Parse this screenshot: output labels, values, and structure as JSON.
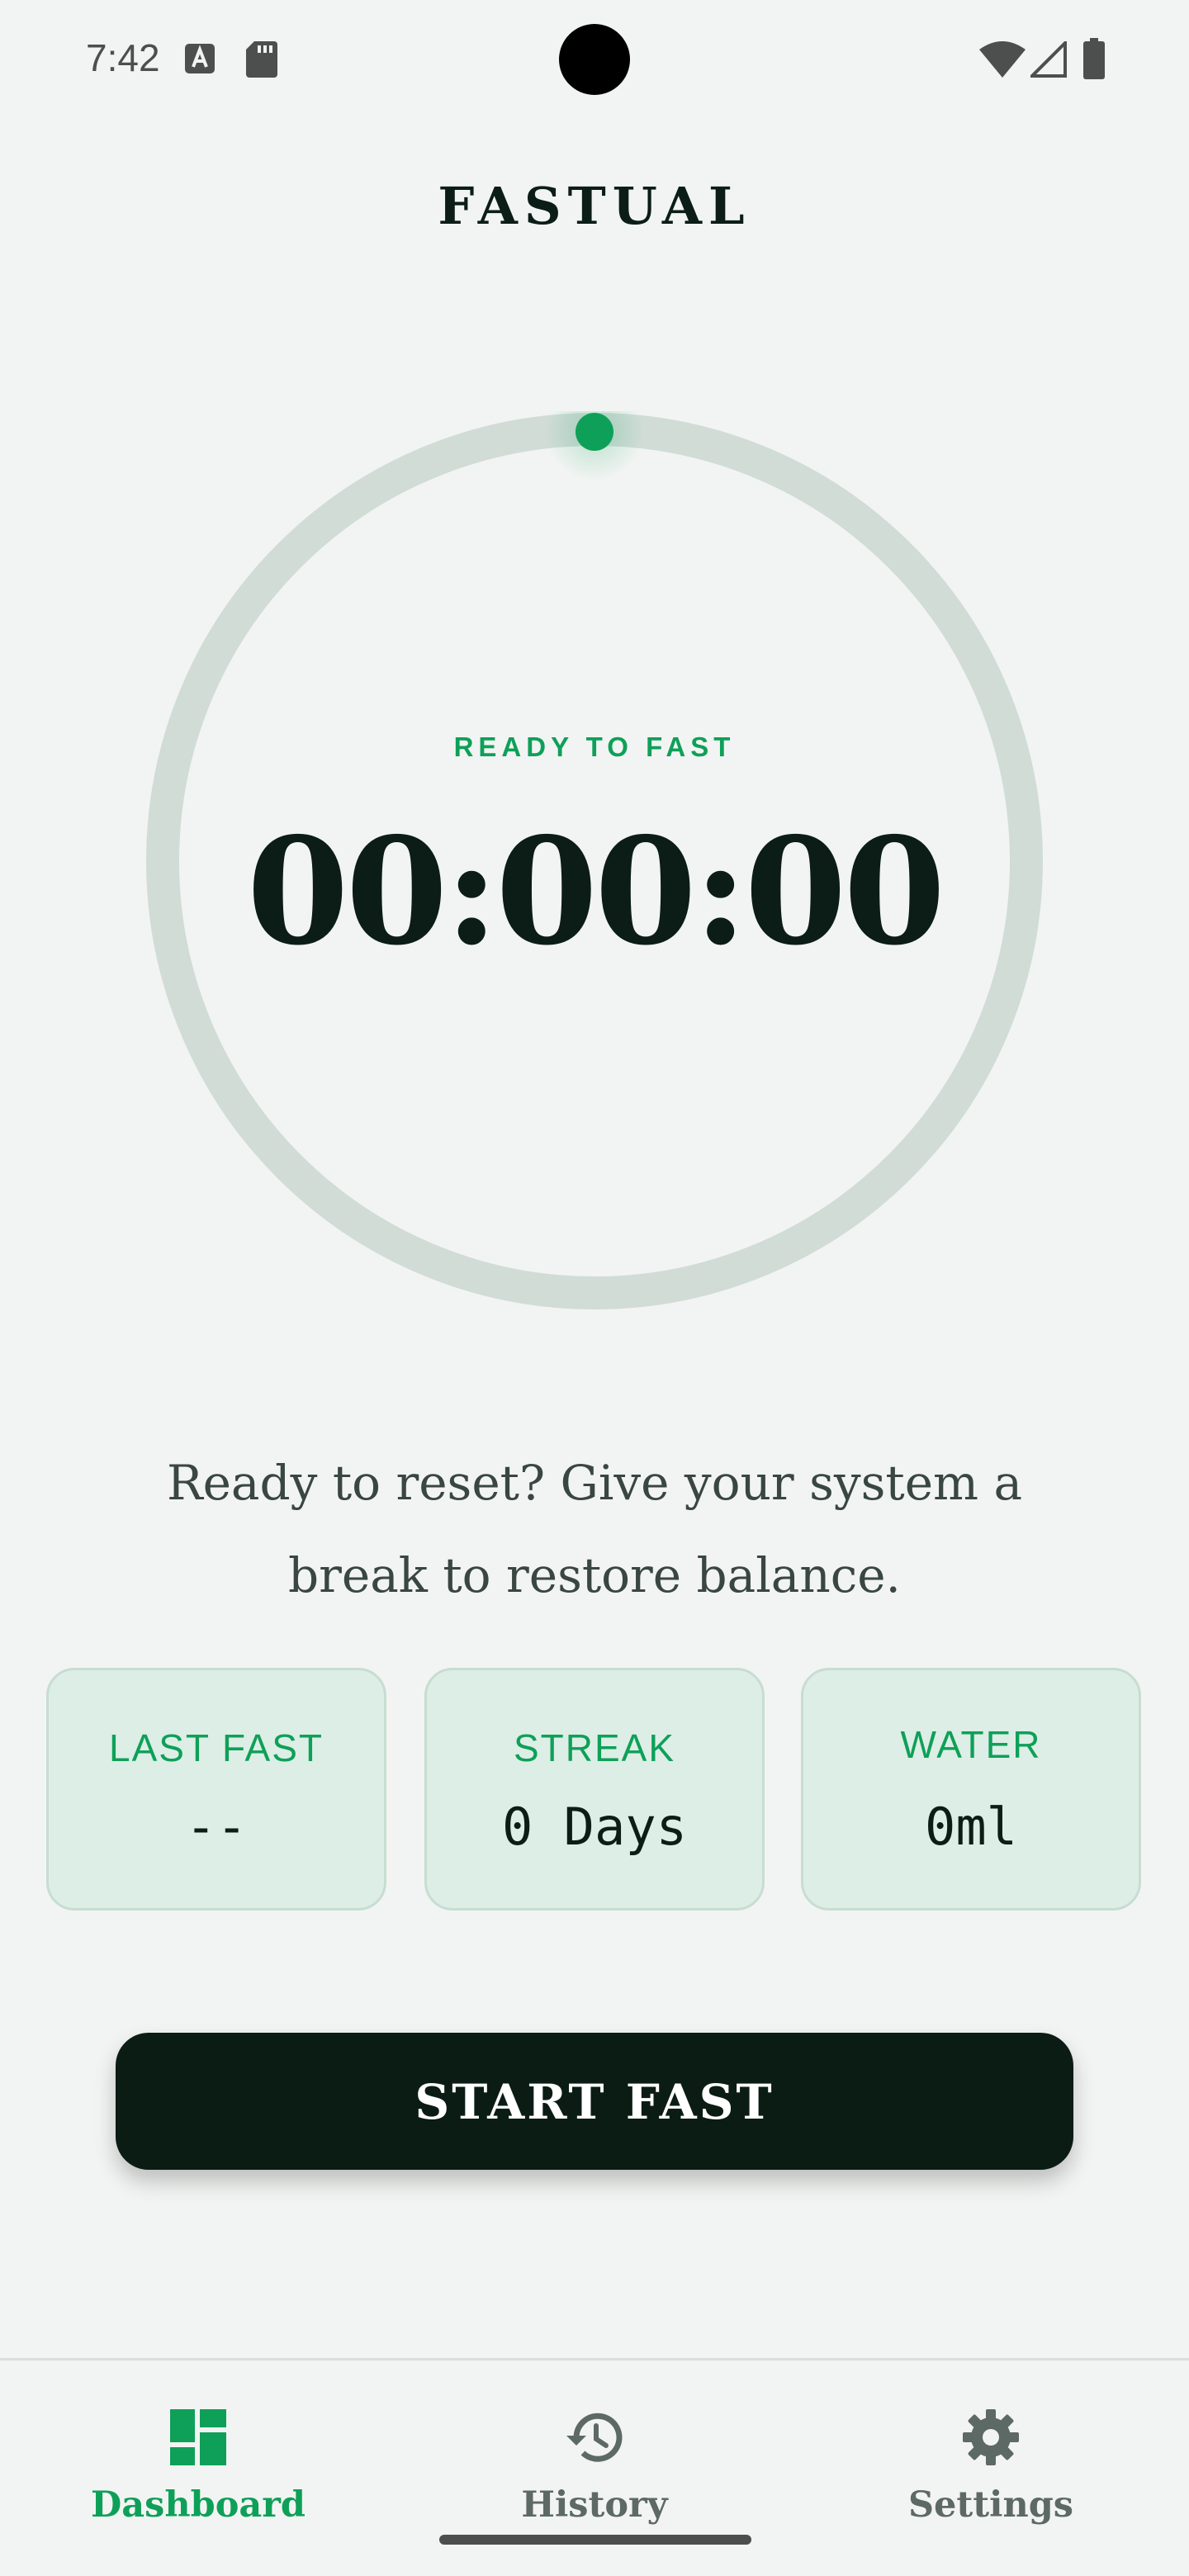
{
  "status_bar": {
    "time": "7:42",
    "icons": [
      "a-notification-icon",
      "sd-card-icon",
      "wifi-icon",
      "cell-signal-icon",
      "battery-icon"
    ]
  },
  "app": {
    "title": "FASTUAL"
  },
  "timer": {
    "status": "READY TO FAST",
    "value": "00:00:00",
    "progress": 0,
    "accent_color": "#0ea058",
    "track_color": "#d1dcd7"
  },
  "message": {
    "text": "Ready to reset? Give your system a break to restore balance."
  },
  "stats": {
    "last_fast": {
      "label": "LAST FAST",
      "value": "--"
    },
    "streak": {
      "label": "STREAK",
      "value": "0 Days"
    },
    "water": {
      "label": "WATER",
      "value": "0ml"
    }
  },
  "actions": {
    "start_label": "START FAST"
  },
  "nav": {
    "items": [
      {
        "label": "Dashboard",
        "icon": "dashboard-icon",
        "active": true
      },
      {
        "label": "History",
        "icon": "history-icon",
        "active": false
      },
      {
        "label": "Settings",
        "icon": "settings-icon",
        "active": false
      }
    ]
  },
  "colors": {
    "background": "#f2f4f3",
    "primary_dark": "#0b1c15",
    "accent_green": "#0ea058",
    "card_bg": "#ddeee6"
  }
}
